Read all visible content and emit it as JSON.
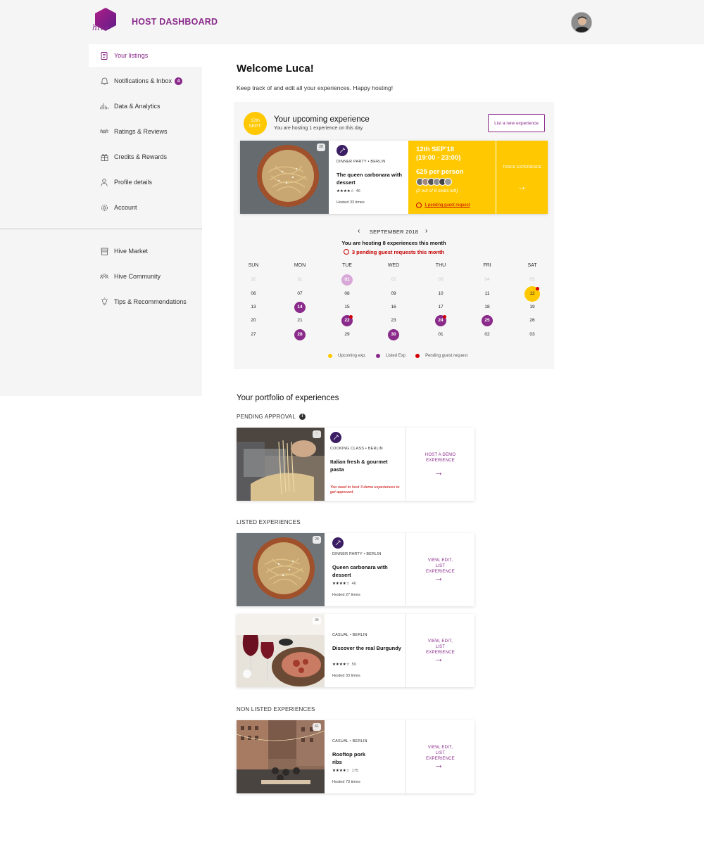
{
  "header": {
    "brand": "hive",
    "title": "HOST DASHBOARD"
  },
  "sidebar": {
    "items": [
      {
        "label": "Your listings",
        "icon": "document-icon"
      },
      {
        "label": "Notifications & Inbox",
        "icon": "bell-icon",
        "badge": "4"
      },
      {
        "label": "Data & Analytics",
        "icon": "bar-chart-icon"
      },
      {
        "label": "Ratings & Reviews",
        "icon": "stars-icon"
      },
      {
        "label": "Credits & Rewards",
        "icon": "gift-icon"
      },
      {
        "label": "Profile details",
        "icon": "user-icon"
      },
      {
        "label": "Account",
        "icon": "gear-icon"
      }
    ],
    "secondary": [
      {
        "label": "Hive Market",
        "icon": "market-icon"
      },
      {
        "label": "Hive Community",
        "icon": "community-icon"
      },
      {
        "label": "Tips & Recommendations",
        "icon": "lightbulb-icon"
      }
    ]
  },
  "main": {
    "welcome": "Welcome Luca!",
    "subtitle": "Keep track of and edit all your experiences. Happy hosting!"
  },
  "upcoming": {
    "badge_line1": "12th",
    "badge_line2": "SEPT'",
    "title": "Your upcoming experience",
    "subtitle": "You are hosting 1 experience on this day",
    "list_new_label": "List a new experience",
    "card": {
      "favorites": "28",
      "category": "DINNER PARTY",
      "city": "BERLIN",
      "name": "The queen carbonara with dessert",
      "stars": "★★★★☆",
      "reviews": "46",
      "hosted": "Hosted 33 times",
      "date": "12th SEP'18",
      "time": "(19:00 - 23:00)",
      "price": "€25 per person",
      "seats": "(2 out of 8 seats left)",
      "pending_link": "1 pending guest request",
      "track_label": "TRACK EXPERIENCE",
      "arrow": "→"
    }
  },
  "calendar": {
    "month": "SEPTEMBER 2018",
    "prev": "‹",
    "next": "›",
    "hosting_text": "You are hosting 8 experiences this month",
    "pending_text": "3 pending guest requests this month",
    "weekdays": [
      "SUN",
      "MON",
      "TUE",
      "WED",
      "THU",
      "FRI",
      "SAT"
    ],
    "weeks": [
      [
        "30",
        "31",
        "01",
        "02",
        "03",
        "04",
        "05"
      ],
      [
        "06",
        "07",
        "08",
        "09",
        "10",
        "11",
        "12"
      ],
      [
        "13",
        "14",
        "15",
        "16",
        "17",
        "18",
        "19"
      ],
      [
        "20",
        "21",
        "22",
        "23",
        "24",
        "25",
        "26"
      ],
      [
        "27",
        "28",
        "29",
        "30",
        "01",
        "02",
        "03"
      ]
    ],
    "muted": [
      [
        0,
        0
      ],
      [
        0,
        1
      ],
      [
        0,
        3
      ],
      [
        0,
        4
      ],
      [
        0,
        5
      ],
      [
        0,
        6
      ]
    ],
    "listed": [
      [
        2,
        1
      ],
      [
        3,
        2
      ],
      [
        3,
        4
      ],
      [
        3,
        5
      ],
      [
        4,
        1
      ],
      [
        4,
        3
      ]
    ],
    "listed_faded": [
      [
        0,
        2
      ]
    ],
    "today": [
      1,
      6
    ],
    "pending": [
      [
        1,
        6
      ],
      [
        3,
        2
      ],
      [
        3,
        4
      ]
    ],
    "legend": {
      "upcoming": "Upcoming exp.",
      "listed": "Listed Exp",
      "pending": "Pending guest request"
    },
    "colors": {
      "upcoming": "#ffc800",
      "listed": "#8a2a8a",
      "pending": "#d40000"
    }
  },
  "portfolio": {
    "title": "Your portfolio of experiences",
    "pending_label": "PENDING APPROVAL",
    "pending_info": "i",
    "listed_label": "LISTED EXPERIENCES",
    "nonlisted_label": "NON LISTED EXPERIENCES",
    "cards": [
      {
        "favorites": "",
        "category": "COOKING CLASS",
        "city": "BERLIN",
        "name": "Italian fresh & gourmet pasta",
        "warning": "You need to host 3 demo experiences to get approved.",
        "action": "HOST A DEMO EXPERIENCE"
      },
      {
        "favorites": "28",
        "category": "DINNER PARTY",
        "city": "BERLIN",
        "name": "Queen carbonara with dessert",
        "stars": "★★★★☆",
        "reviews": "46",
        "hosted": "Hosted 27 times",
        "action": "VIEW, EDIT, LIST EXPERIENCE"
      },
      {
        "favorites": "34",
        "category": "CASUAL",
        "city": "BERLIN",
        "name": "Discover the real Burgundy",
        "stars": "★★★★☆",
        "reviews": "50",
        "hosted": "Hosted 33 times",
        "action": "VIEW, EDIT, LIST EXPERIENCE"
      },
      {
        "favorites": "61",
        "category": "CASUAL",
        "city": "BERLIN",
        "name": "Rooftop pork ribs",
        "stars": "★★★★☆",
        "reviews": "175",
        "hosted": "Hosted 73 times",
        "action": "VIEW, EDIT, LIST EXPERIENCE"
      }
    ],
    "arrow": "→"
  },
  "colors": {
    "brand": "#8a2a8a",
    "accent": "#ffc800",
    "alert": "#c60000"
  }
}
